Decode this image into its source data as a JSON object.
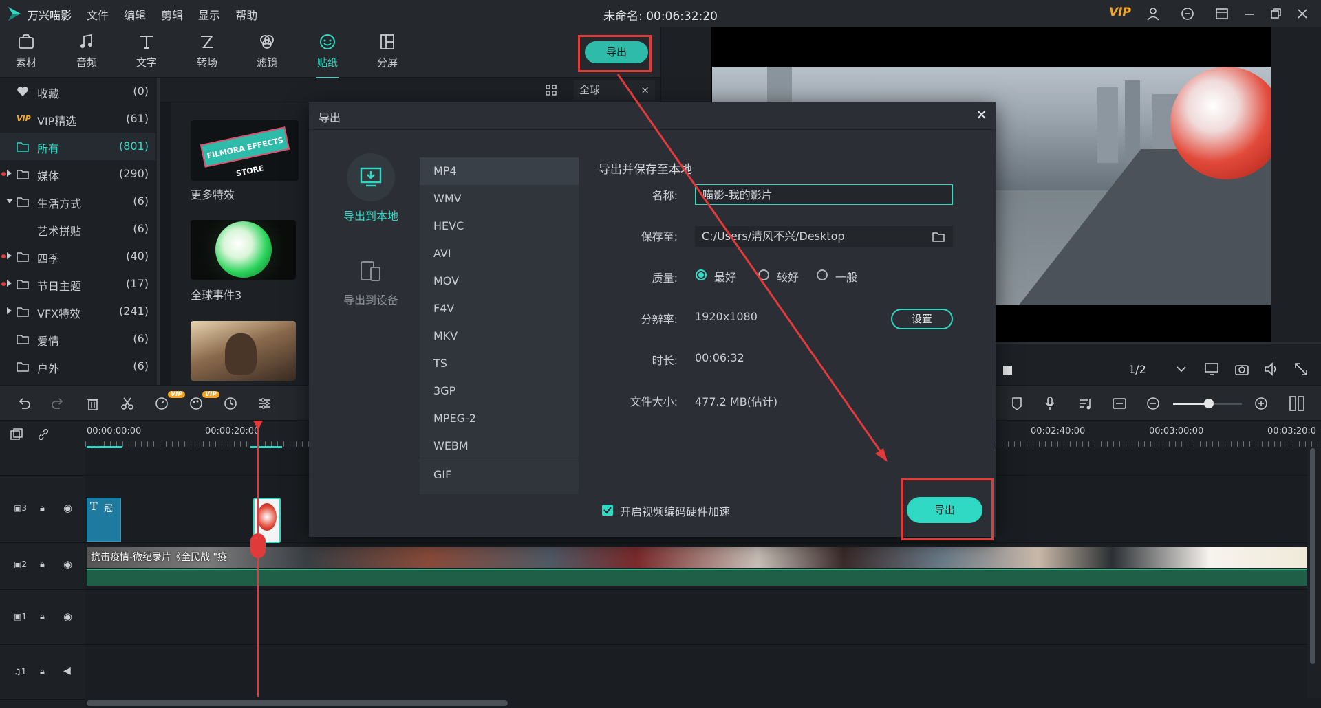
{
  "app": {
    "name": "万兴喵影",
    "menu": [
      "文件",
      "编辑",
      "剪辑",
      "显示",
      "帮助"
    ],
    "title": "未命名: 00:06:32:20",
    "vip": "VIP"
  },
  "toolbar": {
    "tools": [
      {
        "label": "素材",
        "icon": "media-icon"
      },
      {
        "label": "音频",
        "icon": "music-icon"
      },
      {
        "label": "文字",
        "icon": "text-icon"
      },
      {
        "label": "转场",
        "icon": "transition-icon"
      },
      {
        "label": "滤镜",
        "icon": "filter-icon"
      },
      {
        "label": "贴纸",
        "icon": "sticker-icon"
      },
      {
        "label": "分屏",
        "icon": "splitscreen-icon"
      }
    ],
    "active": "贴纸",
    "export_label": "导出"
  },
  "categories": [
    {
      "name": "收藏",
      "count": "(0)"
    },
    {
      "name": "VIP精选",
      "count": "(61)"
    },
    {
      "name": "所有",
      "count": "(801)"
    },
    {
      "name": "媒体",
      "count": "(290)"
    },
    {
      "name": "生活方式",
      "count": "(6)"
    },
    {
      "name": "艺术拼贴",
      "count": "(6)"
    },
    {
      "name": "四季",
      "count": "(40)"
    },
    {
      "name": "节日主题",
      "count": "(17)"
    },
    {
      "name": "VFX特效",
      "count": "(241)"
    },
    {
      "name": "爱情",
      "count": "(6)"
    },
    {
      "name": "户外",
      "count": "(6)"
    }
  ],
  "media": {
    "search_scope": "全球",
    "items": [
      {
        "label": "更多特效",
        "badge": "FILMORA EFFECTS STORE"
      },
      {
        "label": "全球事件3"
      },
      {
        "label": ""
      }
    ]
  },
  "preview": {
    "ratio": "1/2"
  },
  "timeline": {
    "marks": [
      "00:00:00:00",
      "00:00:20:00",
      "00:02:40:00",
      "00:03:00:00",
      "00:03:20:0"
    ],
    "tracks": [
      "3",
      "2",
      "1",
      "1"
    ],
    "clip_title": "抗击疫情-微纪录片《全民战 \"疫",
    "text_clip": "冠"
  },
  "dialog": {
    "title": "导出",
    "destinations": [
      {
        "label": "导出到本地",
        "active": true
      },
      {
        "label": "导出到设备",
        "active": false
      }
    ],
    "formats": [
      "MP4",
      "WMV",
      "HEVC",
      "AVI",
      "MOV",
      "F4V",
      "MKV",
      "TS",
      "3GP",
      "MPEG-2",
      "WEBM",
      "GIF"
    ],
    "selected_format": "MP4",
    "section_title": "导出并保存至本地",
    "name_label": "名称:",
    "name_value": "喵影-我的影片",
    "save_label": "保存至:",
    "save_value": "C:/Users/清风不兴/Desktop",
    "quality_label": "质量:",
    "quality_options": [
      "最好",
      "较好",
      "一般"
    ],
    "quality_selected": "最好",
    "resolution_label": "分辨率:",
    "resolution_value": "1920x1080",
    "settings_label": "设置",
    "duration_label": "时长:",
    "duration_value": "00:06:32",
    "filesize_label": "文件大小:",
    "filesize_value": "477.2 MB(估计)",
    "hw_accel_label": "开启视频编码硬件加速",
    "hw_accel_checked": true,
    "export_label": "导出"
  },
  "colors": {
    "accent": "#2fd9c3",
    "annotation": "#e03a3a"
  }
}
